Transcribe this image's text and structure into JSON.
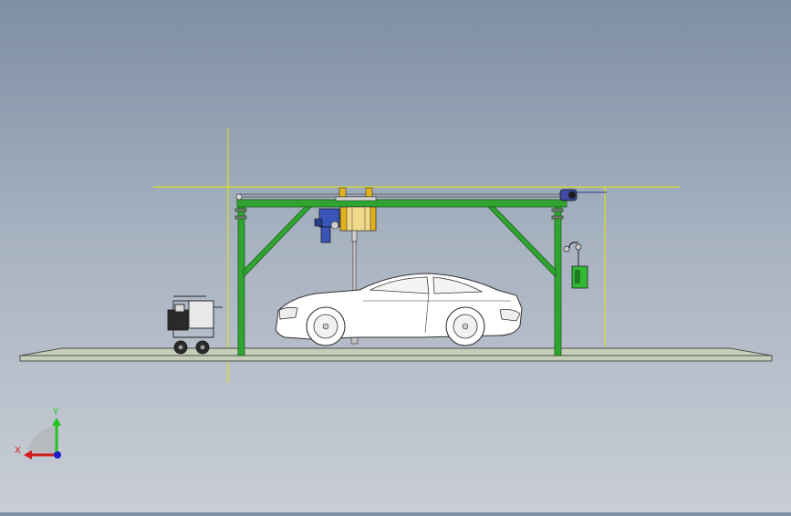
{
  "scene": {
    "colors": {
      "frame": "#2fa52f",
      "frame_edge": "#1e5c1e",
      "guide": "#e8e800",
      "floor": "#c6cdb8",
      "floor_edge": "#4d4d4d",
      "car_body": "#ffffff",
      "car_edge": "#333333",
      "accent_yellow": "#e2b21c",
      "accent_blue": "#3a55b8",
      "box_green": "#32b832"
    }
  },
  "triad": {
    "x_label": "X",
    "y_label": "Y",
    "x_color": "#d01c1c",
    "y_color": "#22c422",
    "z_color": "#1c1cd0"
  }
}
